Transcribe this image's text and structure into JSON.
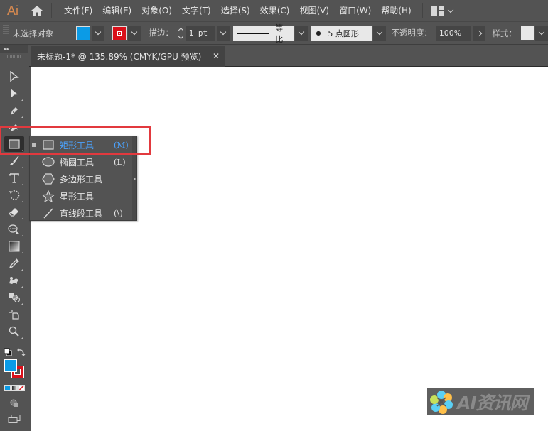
{
  "app": {
    "logo": "Ai"
  },
  "menubar": {
    "items": [
      "文件(F)",
      "编辑(E)",
      "对象(O)",
      "文字(T)",
      "选择(S)",
      "效果(C)",
      "视图(V)",
      "窗口(W)",
      "帮助(H)"
    ]
  },
  "controlbar": {
    "selection_status": "未选择对象",
    "fill_color": "#0b9be6",
    "stroke_color": "#d9101a",
    "stroke_label": "描边：",
    "stroke_weight": "1 pt",
    "stroke_profile_label": "等比",
    "brush_dot": "●",
    "brush_label": "5  点圆形",
    "opacity_label": "不透明度：",
    "opacity_value": "100%",
    "style_label": "样式："
  },
  "document": {
    "tab_title": "未标题-1* @ 135.89% (CMYK/GPU 预览)",
    "close_glyph": "✕"
  },
  "toolbar": {
    "collapse_glyph": "▸▸",
    "fill_color": "#0b9be6",
    "stroke_color": "#d9101a"
  },
  "flyout": {
    "items": [
      {
        "label": "矩形工具",
        "shortcut": "(M)",
        "icon": "rectangle-icon",
        "selected": true
      },
      {
        "label": "椭圆工具",
        "shortcut": "(L)",
        "icon": "ellipse-icon",
        "selected": false
      },
      {
        "label": "多边形工具",
        "shortcut": "",
        "icon": "polygon-icon",
        "selected": false
      },
      {
        "label": "星形工具",
        "shortcut": "",
        "icon": "star-icon",
        "selected": false
      },
      {
        "label": "直线段工具",
        "shortcut": "(\\)",
        "icon": "line-segment-icon",
        "selected": false
      }
    ]
  },
  "watermark": {
    "text": "AI资讯网"
  },
  "colors": {
    "accent_blue": "#4ba3ff",
    "highlight_red": "#e2393e",
    "ui_bg": "#535353"
  }
}
